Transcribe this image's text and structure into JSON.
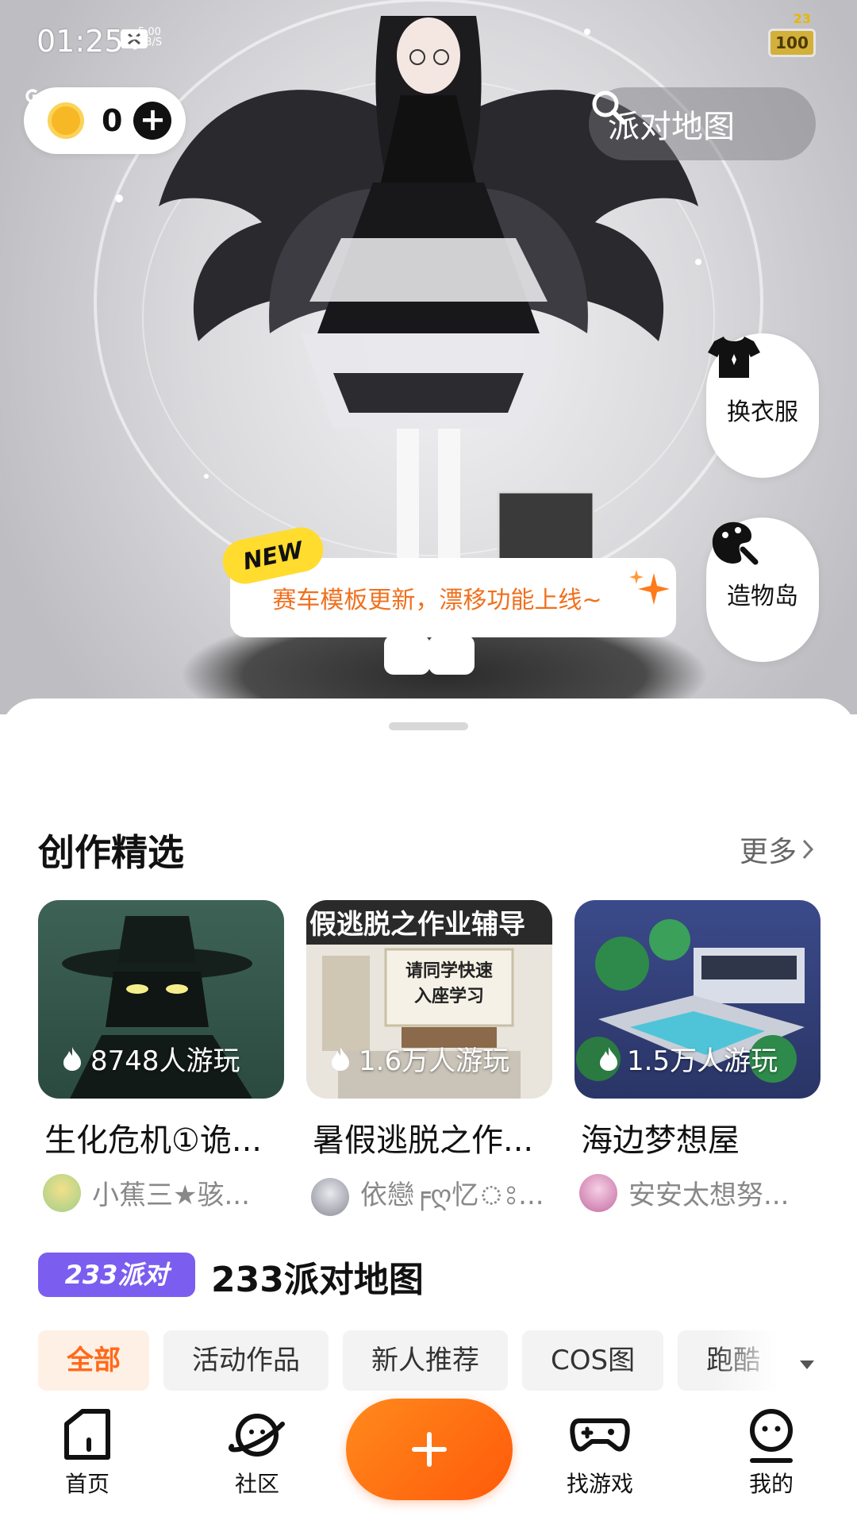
{
  "status": {
    "time": "01:25",
    "net_speed_top": "5.00",
    "net_speed_bottom": "KB/S",
    "battery": "100",
    "battery_mini": "23"
  },
  "top": {
    "coin_count": "0",
    "search_text": "派对地图"
  },
  "side_buttons": {
    "wardrobe": "换衣服",
    "creation_island": "造物岛"
  },
  "banner": {
    "badge": "NEW",
    "text": "赛车模板更新，漂移功能上线~"
  },
  "featured": {
    "title": "创作精选",
    "more": "更多",
    "cards": [
      {
        "plays": "8748人游玩",
        "title": "生化危机①诡...",
        "author": "小蕉三★骇..."
      },
      {
        "plays": "1.6万人游玩",
        "title": "暑假逃脱之作...",
        "author": "依戀╒ღ忆ঃ...",
        "thumb_heading": "假逃脱之作业辅导",
        "thumb_board_line1": "请同学快速",
        "thumb_board_line2": "入座学习"
      },
      {
        "plays": "1.5万人游玩",
        "title": "海边梦想屋",
        "author": "安安太想努..."
      }
    ]
  },
  "party": {
    "badge": "233派对",
    "title": "233派对地图",
    "chips": [
      "全部",
      "活动作品",
      "新人推荐",
      "COS图",
      "跑酷"
    ]
  },
  "nav": {
    "home": "首页",
    "community": "社区",
    "find_games": "找游戏",
    "me": "我的"
  },
  "colors": {
    "accent": "#ff6a1a",
    "party_purple": "#7b5df0",
    "banner_text": "#f0701e"
  }
}
